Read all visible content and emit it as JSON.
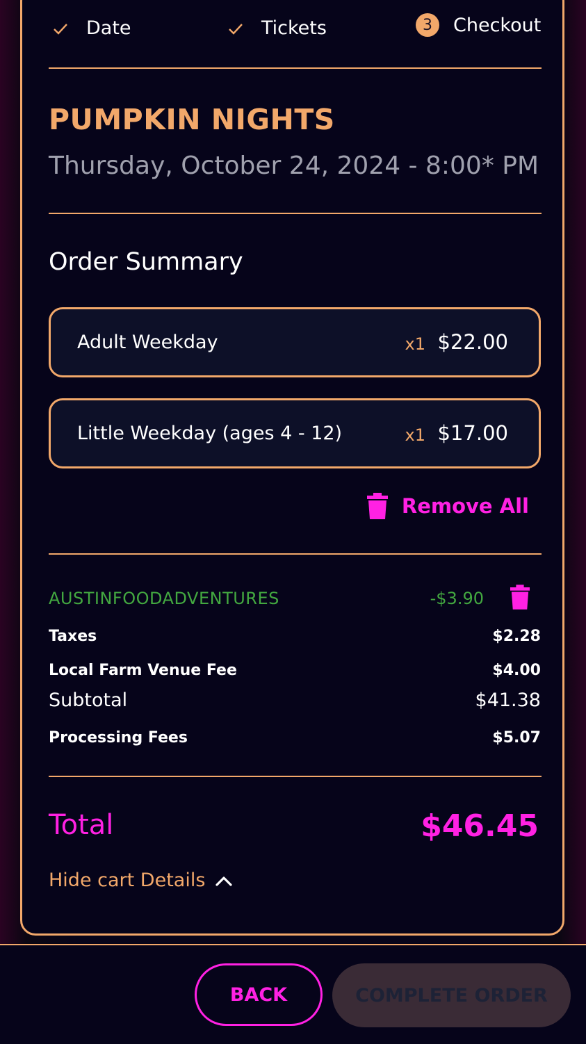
{
  "steps": [
    {
      "label": "Date",
      "status": "done"
    },
    {
      "label": "Tickets",
      "status": "done"
    },
    {
      "label": "Checkout",
      "number": "3",
      "status": "current"
    }
  ],
  "event": {
    "title": "PUMPKIN NIGHTS",
    "datetime": "Thursday, October 24, 2024 - 8:00* PM"
  },
  "order": {
    "heading": "Order Summary",
    "items": [
      {
        "name": "Adult Weekday",
        "qty": "x1",
        "price": "$22.00"
      },
      {
        "name": "Little Weekday (ages 4 - 12)",
        "qty": "x1",
        "price": "$17.00"
      }
    ],
    "remove_all_label": "Remove All"
  },
  "summary": {
    "promo_code": "AUSTINFOODADVENTURES",
    "promo_discount": "-$3.90",
    "taxes_label": "Taxes",
    "taxes_value": "$2.28",
    "venue_fee_label": "Local Farm Venue Fee",
    "venue_fee_value": "$4.00",
    "subtotal_label": "Subtotal",
    "subtotal_value": "$41.38",
    "processing_label": "Processing Fees",
    "processing_value": "$5.07",
    "total_label": "Total",
    "total_value": "$46.45",
    "hide_cart_label": "Hide cart Details"
  },
  "actions": {
    "back_label": "BACK",
    "complete_label": "COMPLETE ORDER"
  },
  "colors": {
    "accent_orange": "#f2a86a",
    "accent_magenta": "#ff21e3",
    "promo_green": "#43a840",
    "background": "#06041a"
  },
  "icons": [
    "check-icon",
    "trash-icon",
    "chevron-up-icon"
  ]
}
